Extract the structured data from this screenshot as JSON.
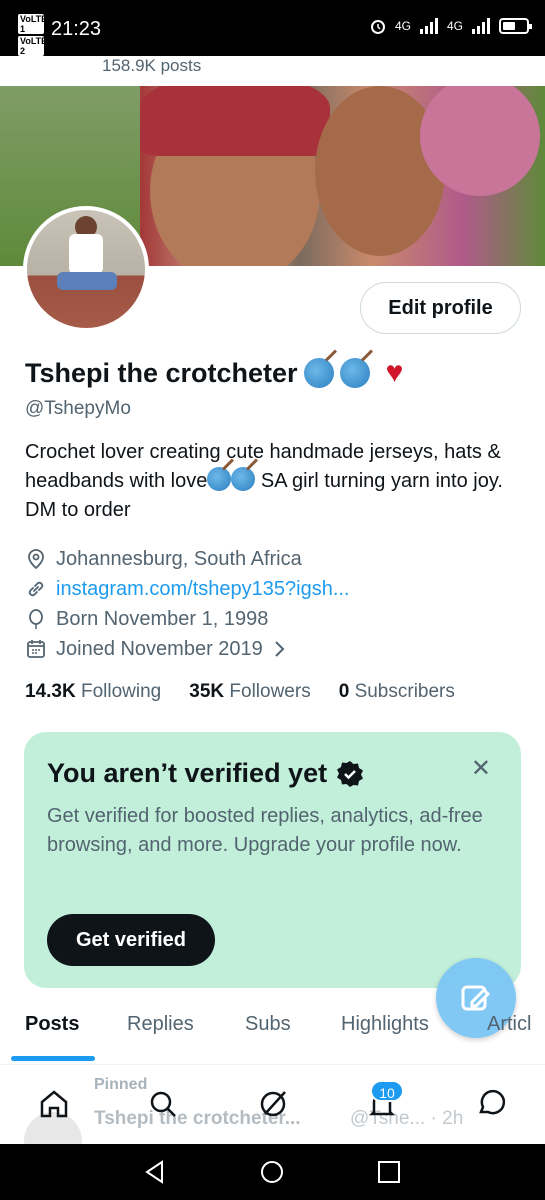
{
  "status_bar": {
    "time": "21:23",
    "volte1": "VoLTE 1",
    "volte2": "VoLTE 2",
    "net1": "4G",
    "net2": "4G"
  },
  "header": {
    "post_count": "158.9K posts"
  },
  "profile": {
    "edit_label": "Edit profile",
    "name": "Tshepi the crotcheter",
    "handle": "@TshepyMo",
    "bio_part1": "Crochet lover creating cute handmade jerseys, hats & headbands with love",
    "bio_part2": " SA girl turning yarn into joy. DM to order",
    "location": "Johannesburg, South Africa",
    "link": "instagram.com/tshepy135?igsh...",
    "born": "Born November 1, 1998",
    "joined": "Joined November 2019",
    "following_count": "14.3K",
    "following_label": "Following",
    "followers_count": "35K",
    "followers_label": "Followers",
    "subscribers_count": "0",
    "subscribers_label": "Subscribers"
  },
  "verify_card": {
    "title": "You aren’t verified yet",
    "description": "Get verified for boosted replies, analytics, ad-free browsing, and more. Upgrade your profile now.",
    "cta": "Get verified"
  },
  "tabs": [
    "Posts",
    "Replies",
    "Subs",
    "Highlights",
    "Articl"
  ],
  "pinned": {
    "label": "Pinned",
    "name": "Tshepi the crotcheter...",
    "handle": "@Tshe...",
    "time": "· 2h"
  },
  "bottom_nav": {
    "badge": "10"
  },
  "colors": {
    "accent": "#1d9bf0",
    "verify_bg": "#c2efd9",
    "heart": "#d1152a"
  }
}
